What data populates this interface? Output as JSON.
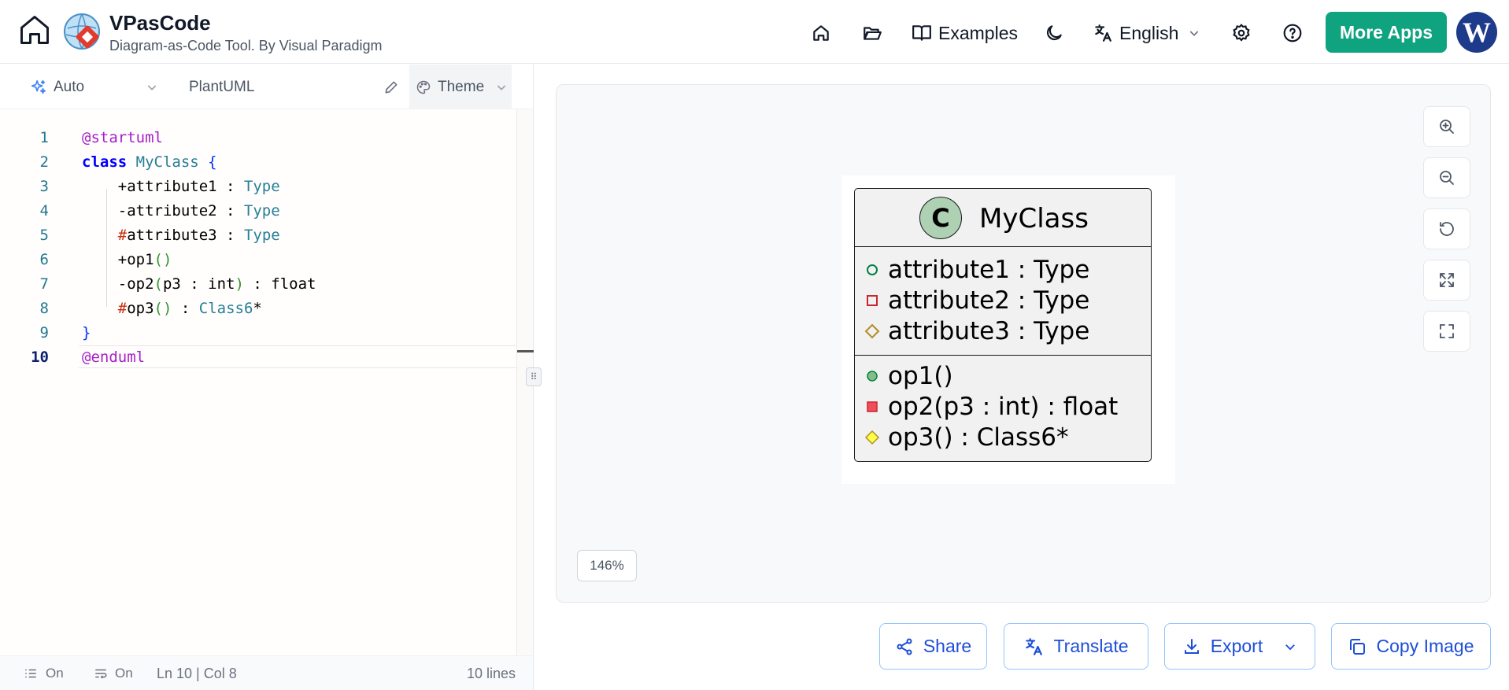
{
  "app": {
    "title": "VPasCode",
    "subtitle": "Diagram-as-Code Tool. By Visual Paradigm"
  },
  "nav": {
    "examples_label": "Examples",
    "language_label": "English",
    "more_apps_label": "More Apps",
    "avatar_letter": "W"
  },
  "editor": {
    "mode_label": "Auto",
    "language_label": "PlantUML",
    "theme_label": "Theme",
    "lines": [
      [
        {
          "t": "@startuml",
          "c": "k-dir"
        }
      ],
      [
        {
          "t": "class ",
          "c": "k-kw"
        },
        {
          "t": "MyClass ",
          "c": "k-cls"
        },
        {
          "t": "{",
          "c": "k-br"
        }
      ],
      [
        {
          "t": "    +attribute1 : ",
          "c": "k-def"
        },
        {
          "t": "Type",
          "c": "k-type"
        }
      ],
      [
        {
          "t": "    -attribute2 : ",
          "c": "k-def"
        },
        {
          "t": "Type",
          "c": "k-type"
        }
      ],
      [
        {
          "t": "    ",
          "c": "k-def"
        },
        {
          "t": "#",
          "c": "k-hash"
        },
        {
          "t": "attribute3 : ",
          "c": "k-def"
        },
        {
          "t": "Type",
          "c": "k-type"
        }
      ],
      [
        {
          "t": "    +op1",
          "c": "k-def"
        },
        {
          "t": "()",
          "c": "k-par"
        }
      ],
      [
        {
          "t": "    -op2",
          "c": "k-def"
        },
        {
          "t": "(",
          "c": "k-par"
        },
        {
          "t": "p3 : int",
          "c": "k-def"
        },
        {
          "t": ")",
          "c": "k-par"
        },
        {
          "t": " : float",
          "c": "k-def"
        }
      ],
      [
        {
          "t": "    ",
          "c": "k-def"
        },
        {
          "t": "#",
          "c": "k-hash"
        },
        {
          "t": "op3",
          "c": "k-def"
        },
        {
          "t": "()",
          "c": "k-par"
        },
        {
          "t": " : ",
          "c": "k-def"
        },
        {
          "t": "Class6",
          "c": "k-type"
        },
        {
          "t": "*",
          "c": "k-def"
        }
      ],
      [
        {
          "t": "}",
          "c": "k-br"
        }
      ],
      [
        {
          "t": "@enduml",
          "c": "k-dir"
        }
      ]
    ],
    "active_line": 10,
    "status": {
      "toggle1_label": "On",
      "toggle2_label": "On",
      "position": "Ln 10 | Col 8",
      "line_count": "10 lines"
    }
  },
  "diagram": {
    "class_marker": "C",
    "class_name": "MyClass",
    "attributes": [
      {
        "text": "attribute1 : Type",
        "visibility": "public"
      },
      {
        "text": "attribute2 : Type",
        "visibility": "private"
      },
      {
        "text": "attribute3 : Type",
        "visibility": "protected"
      }
    ],
    "operations": [
      {
        "text": "op1()",
        "visibility": "public"
      },
      {
        "text": "op2(p3 : int) : float",
        "visibility": "private"
      },
      {
        "text": "op3() : Class6*",
        "visibility": "protected"
      }
    ],
    "zoom": "146%"
  },
  "actions": {
    "share_label": "Share",
    "translate_label": "Translate",
    "export_label": "Export",
    "copy_label": "Copy Image"
  },
  "colors": {
    "accent_green": "#10a37f",
    "action_blue": "#1d4ed8",
    "uml_header_circle": "#add1b2"
  }
}
